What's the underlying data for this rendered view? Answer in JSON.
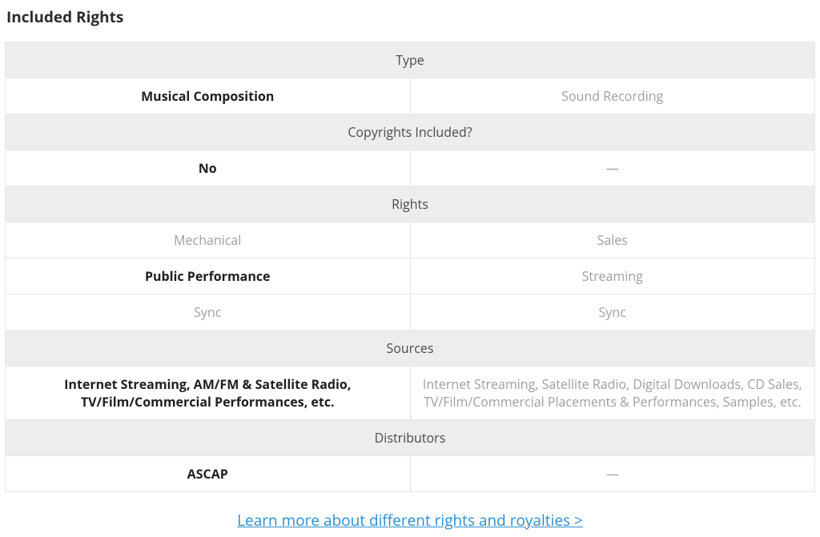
{
  "section_title": "Included Rights",
  "groups": [
    {
      "header": "Type",
      "rows": [
        {
          "left": "Musical Composition",
          "left_selected": true,
          "right": "Sound Recording"
        }
      ]
    },
    {
      "header": "Copyrights Included?",
      "rows": [
        {
          "left": "No",
          "left_selected": true,
          "right": "—"
        }
      ]
    },
    {
      "header": "Rights",
      "rows": [
        {
          "left": "Mechanical",
          "left_selected": false,
          "right": "Sales"
        },
        {
          "left": "Public Performance",
          "left_selected": true,
          "right": "Streaming"
        },
        {
          "left": "Sync",
          "left_selected": false,
          "right": "Sync"
        }
      ]
    },
    {
      "header": "Sources",
      "rows": [
        {
          "left": "Internet Streaming, AM/FM & Satellite Radio, TV/Film/Commercial Performances, etc.",
          "left_selected": true,
          "right": "Internet Streaming, Satellite Radio, Digital Downloads, CD Sales, TV/Film/Commercial Placements & Performances, Samples, etc."
        }
      ]
    },
    {
      "header": "Distributors",
      "rows": [
        {
          "left": "ASCAP",
          "left_selected": true,
          "right": "—"
        }
      ]
    }
  ],
  "learn_more_label": "Learn more about different rights and royalties >"
}
